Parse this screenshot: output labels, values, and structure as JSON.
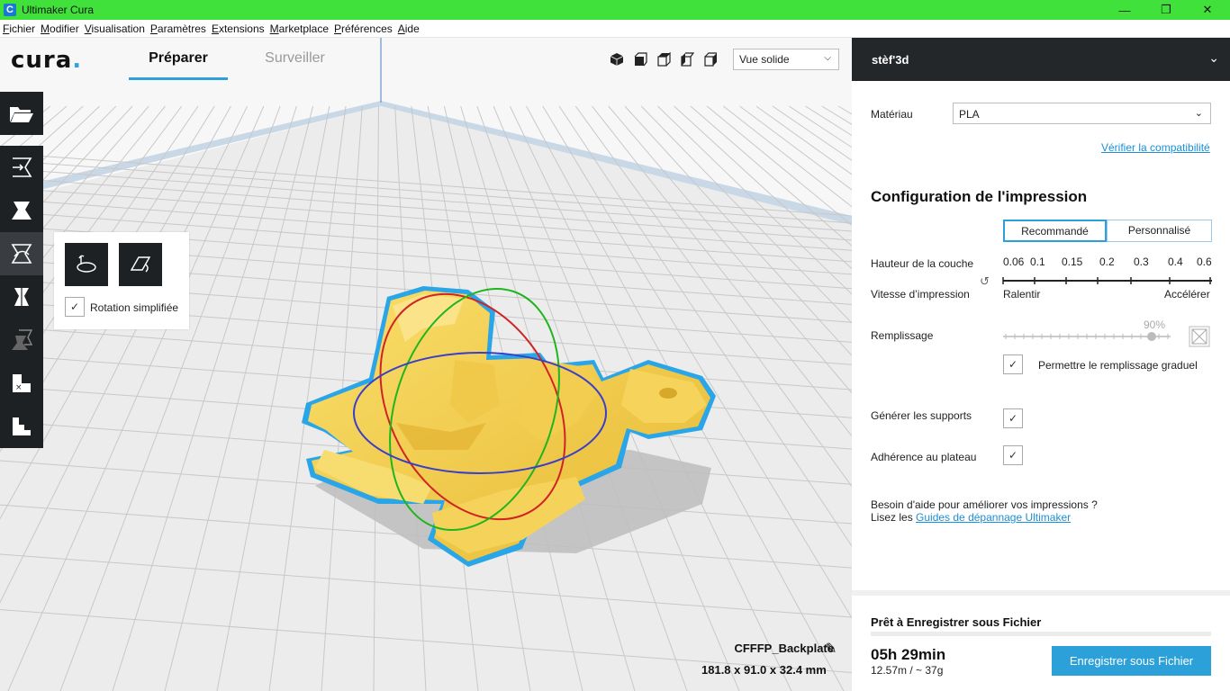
{
  "window": {
    "title": "Ultimaker Cura",
    "app_icon_letter": "C"
  },
  "menu": [
    "Fichier",
    "Modifier",
    "Visualisation",
    "Paramètres",
    "Extensions",
    "Marketplace",
    "Préférences",
    "Aide"
  ],
  "header": {
    "logo_text": "cura",
    "logo_dot": ".",
    "tabs": [
      "Préparer",
      "Surveiller"
    ],
    "view_mode": "Vue solide",
    "view_icons": [
      "3d-view-icon",
      "front-view-icon",
      "top-view-icon",
      "left-view-icon",
      "right-view-icon"
    ]
  },
  "toolbar": {
    "tools": [
      "open-file-icon",
      "move-tool-icon",
      "scale-tool-icon",
      "rotate-tool-icon",
      "mirror-tool-icon",
      "per-model-settings-icon",
      "support-blocker-icon",
      "layer-view-icon"
    ],
    "rotation_panel": {
      "lay_flat_icon": "reset-rotation-icon",
      "select_face_icon": "lay-flat-icon",
      "checkbox_label": "Rotation simplifiée",
      "checked": true
    }
  },
  "object": {
    "name": "CFFFP_Backplate",
    "dimensions": "181.8 x 91.0 x 32.4 mm"
  },
  "panel": {
    "machine": "stèf'3d",
    "material_label": "Matériau",
    "material_value": "PLA",
    "compat_link": "Vérifier la compatibilité",
    "config_title": "Configuration de l'impression",
    "mode_recommended": "Recommandé",
    "mode_custom": "Personnalisé",
    "layer_height_label": "Hauteur de la couche",
    "layer_values": [
      "0.06",
      "0.1",
      "0.15",
      "0.2",
      "0.3",
      "0.4",
      "0.6"
    ],
    "speed_label": "Vitesse d’impression",
    "speed_slow": "Ralentir",
    "speed_fast": "Accélérer",
    "infill_label": "Remplissage",
    "infill_value": "90%",
    "infill_fraction": 0.9,
    "gradual_label": "Permettre le remplissage graduel",
    "supports_label": "Générer les supports",
    "adhesion_label": "Adhérence au plateau",
    "help_text": "Besoin d'aide pour améliorer vos impressions ?",
    "help_prefix": "Lisez les ",
    "help_link": "Guides de dépannage Ultimaker",
    "ready_title": "Prêt à Enregistrer sous Fichier",
    "print_time": "05h 29min",
    "print_material": "12.57m / ~ 37g",
    "save_button": "Enregistrer sous Fichier"
  },
  "colors": {
    "accent": "#2ba0d9",
    "titlebar": "#3fe13a",
    "model": "#f4cf4c",
    "outline": "#30a8e6",
    "toolbar": "#1e2124"
  }
}
